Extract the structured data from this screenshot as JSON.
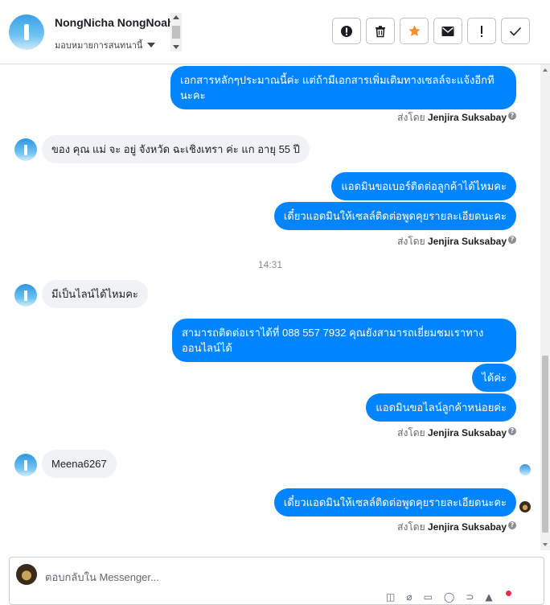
{
  "header": {
    "name": "NongNicha NongNoah",
    "assign_label": "มอบหมายการสนทนานี้"
  },
  "actions": [
    {
      "name": "report-icon",
      "glyph": "!"
    },
    {
      "name": "trash-icon",
      "glyph": "🗑"
    },
    {
      "name": "star-icon",
      "glyph": "★"
    },
    {
      "name": "envelope-icon",
      "glyph": "✉"
    },
    {
      "name": "exclamation-icon",
      "glyph": "!"
    },
    {
      "name": "check-icon",
      "glyph": "✓"
    }
  ],
  "messages": {
    "m1": "เอกสารหลักๆประมาณนี้ค่ะ แต่ถ้ามีเอกสารเพิ่มเติมทางเซลล์จะแจ้งอีกทีนะคะ",
    "m2": "ของ คุณ แม่ จะ อยู่ จังหวัด ฉะเชิงเทรา ค่ะ แก อายุ 55 ปี",
    "m3": "แอดมินขอเบอร์ติดต่อลูกค้าได้ไหมคะ",
    "m4": "เดี๋ยวแอดมินให้เซลล์ติดต่อพูดคุยรายละเอียดนะคะ",
    "time": "14:31",
    "m5": "มีเป็นไลน์ได้ไหมคะ",
    "m6": "สามารถติดต่อเราได้ที่ 088 557 7932 คุณยังสามารถเยี่ยมชมเราทางออนไลน์ได้",
    "m7": "ได้ค่ะ",
    "m8": "แอดมินขอไลน์ลูกค้าหน่อยค่ะ",
    "m9": "Meena6267",
    "m10": "เดี๋ยวแอดมินให้เซลล์ติดต่อพูดคุยรายละเอียดนะคะ"
  },
  "sent_by": {
    "prefix": "ส่งโดย",
    "agent": "Jenjira Suksabay"
  },
  "composer": {
    "placeholder": "ตอบกลับใน Messenger..."
  },
  "colors": {
    "outgoing": "#0084ff",
    "incoming": "#f0f2f5",
    "star": "#f5922f"
  }
}
